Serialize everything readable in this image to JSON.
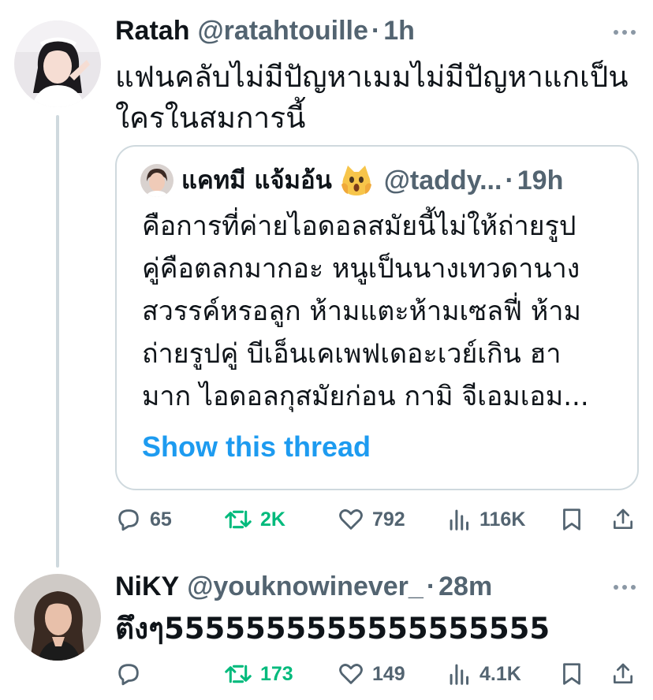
{
  "tweets": [
    {
      "name": "Ratah",
      "handle": "@ratahtouille",
      "separator": "·",
      "time": "1h",
      "text_line1": "แฟนคลับไม่มีปัญหาเมมไม่มีปัญหาแกเป็น",
      "text_line2": "ใครในสมการนี้",
      "quote": {
        "name": "แคทมี แจ้มอ้น",
        "emoji": "face-screaming-cat-emoji",
        "handle": "@taddy...",
        "separator": "·",
        "time": "19h",
        "lines": [
          "คือการที่ค่ายไอดอลสมัยนี้ไม่ให้ถ่ายรูป",
          "คู่คือตลกมากอะ หนูเป็นนางเทวดานาง",
          "สวรรค์หรอลูก ห้ามแตะห้ามเซลฟี่ ห้าม",
          "ถ่ายรูปคู่ บีเอ็นเคเพฟเดอะเวย์เกิน ฮา",
          "มาก ไอดอลกุสมัยก่อน กามิ จีเอมเอม..."
        ],
        "show_thread": "Show this thread"
      },
      "actions": {
        "replies": "65",
        "retweets": "2K",
        "likes": "792",
        "views": "116K"
      }
    },
    {
      "name": "NiKY",
      "handle": "@youknowinever_",
      "separator": "·",
      "time": "28m",
      "text_line1": "ตึงๆ5555555555555555555",
      "actions": {
        "replies": "",
        "retweets": "173",
        "likes": "149",
        "views": "4.1K"
      }
    }
  ],
  "colors": {
    "text": "#0f1419",
    "secondary": "#536471",
    "link": "#1d9bf0",
    "retweet_active": "#00ba7c",
    "border": "#cfd9de"
  },
  "icons": [
    "reply-icon",
    "retweet-icon",
    "like-icon",
    "views-icon",
    "bookmark-icon",
    "share-icon",
    "more-icon"
  ]
}
